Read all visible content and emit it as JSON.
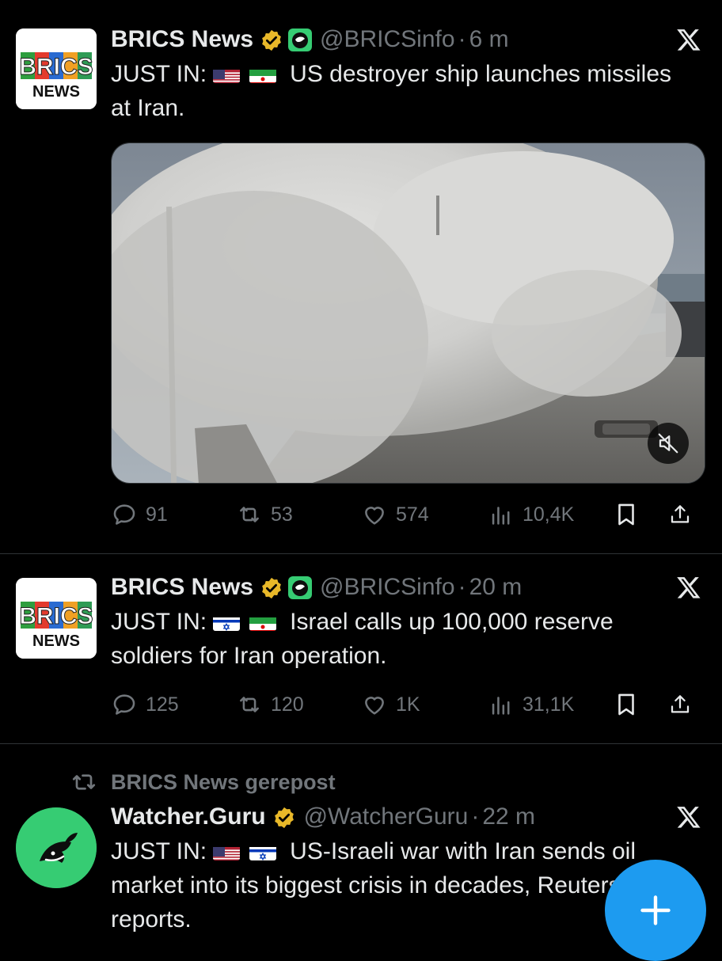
{
  "colors": {
    "background": "#000000",
    "text_primary": "#e7e9ea",
    "text_secondary": "#71767b",
    "divider": "#2f3336",
    "verified_gold": "#e8b829",
    "affiliate_green": "#36cc73",
    "fab_blue": "#1d9bf0"
  },
  "icons": {
    "verified": "verified-gold-badge-icon",
    "affiliate": "affiliate-badge-icon",
    "platform": "x-logo-icon",
    "reply": "reply-icon",
    "repost": "repost-icon",
    "like": "heart-icon",
    "views": "views-icon",
    "bookmark": "bookmark-icon",
    "share": "share-icon",
    "mute": "muted-speaker-icon",
    "compose": "plus-icon"
  },
  "avatars": {
    "brics": {
      "line1": "BRICS",
      "line2": "NEWS"
    }
  },
  "posts": [
    {
      "display_name": "BRICS News",
      "handle": "@BRICSinfo",
      "separator": "·",
      "time": "6 m",
      "text_prefix": "JUST IN:",
      "flags": [
        "us",
        "iran"
      ],
      "text": "US destroyer ship launches missiles at Iran.",
      "has_media": true,
      "media_type": "video",
      "stats": {
        "replies": "91",
        "reposts": "53",
        "likes": "574",
        "views": "10,4K"
      }
    },
    {
      "display_name": "BRICS News",
      "handle": "@BRICSinfo",
      "separator": "·",
      "time": "20 m",
      "text_prefix": "JUST IN:",
      "flags": [
        "israel",
        "iran"
      ],
      "text": "Israel calls up 100,000 reserve soldiers for Iran operation.",
      "has_media": false,
      "stats": {
        "replies": "125",
        "reposts": "120",
        "likes": "1K",
        "views": "31,1K"
      }
    },
    {
      "repost_context": "BRICS News gerepost",
      "display_name": "Watcher.Guru",
      "handle": "@WatcherGuru",
      "separator": "·",
      "time": "22 m",
      "text_prefix": "JUST IN:",
      "flags": [
        "us",
        "israel"
      ],
      "text": "US-Israeli war with Iran sends oil market into its biggest crisis in decades, Reuters reports."
    }
  ],
  "compose_button_label": "+"
}
